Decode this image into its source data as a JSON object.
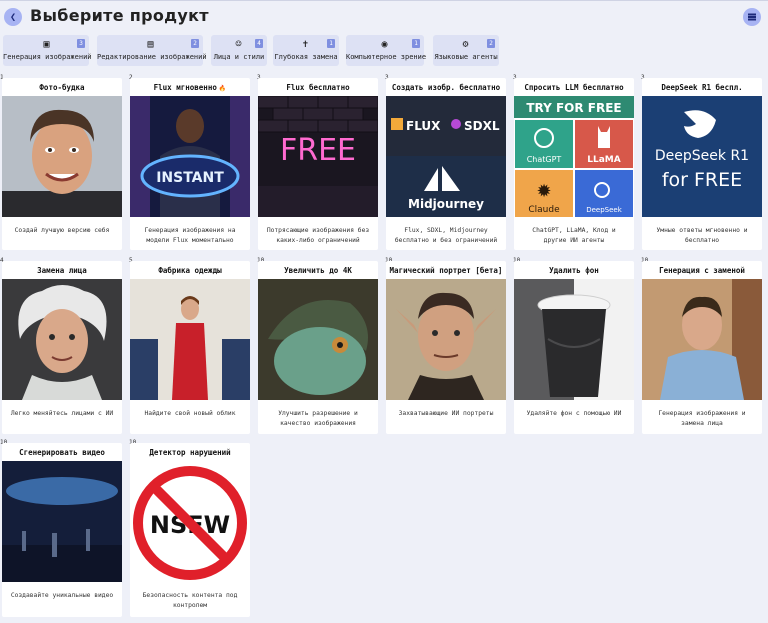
{
  "header": {
    "title": "Выберите продукт"
  },
  "categories": [
    {
      "label": "Генерация изображений",
      "count": "3",
      "icon": "image-edit-icon"
    },
    {
      "label": "Редактирование изображений",
      "count": "2",
      "icon": "image-pencil-icon"
    },
    {
      "label": "Лица и стили",
      "count": "4",
      "icon": "face-frame-icon"
    },
    {
      "label": "Глубокая замена",
      "count": "1",
      "icon": "person-swap-icon"
    },
    {
      "label": "Компьютерное зрение",
      "count": "1",
      "icon": "scan-icon"
    },
    {
      "label": "Языковые агенты",
      "count": "2",
      "icon": "agent-icon"
    }
  ],
  "cards": [
    {
      "num": "1",
      "title": "Фото-будка",
      "desc": "Создай лучшую версию себя",
      "img": "portrait-photo"
    },
    {
      "num": "2",
      "title": "Flux мгновенно",
      "hot": "🔥",
      "desc": "Генерация изображения на модели Flux моментально",
      "img": "instant-neon",
      "img_text": "INSTANT"
    },
    {
      "num": "3",
      "title": "Flux бесплатно",
      "desc": "Потрясающие изображения без каких-либо ограничений",
      "img": "free-neon",
      "img_text": "FREE"
    },
    {
      "num": "3",
      "title": "Создать изобр. бесплатно",
      "desc": "Flux, SDXL, Midjourney бесплатно и без ограничений",
      "img": "flux-sdxl-mj",
      "logos": [
        "FLUX",
        "SDXL",
        "Midjourney"
      ]
    },
    {
      "num": "3",
      "title": "Спросить LLM бесплатно",
      "desc": "ChatGPT, LLaMA, Клод и другие ИИ агенты",
      "img": "llm-grid",
      "banner": "TRY FOR FREE",
      "logos": [
        "ChatGPT",
        "LLaMA",
        "Claude",
        "DeepSeek"
      ]
    },
    {
      "num": "3",
      "title": "DeepSeek R1 беспл.",
      "desc": "Умные ответы мгновенно и бесплатно",
      "img": "deepseek",
      "img_text": [
        "DeepSeek R1",
        "for FREE"
      ]
    },
    {
      "num": "4",
      "title": "Замена лица",
      "desc": "Легко меняйтесь лицами с ИИ",
      "img": "old-man-portrait"
    },
    {
      "num": "5",
      "title": "Фабрика одежды",
      "desc": "Найдите свой новый облик",
      "img": "flight-attendant"
    },
    {
      "num": "10",
      "title": "Увеличить до 4K",
      "desc": "Улучшить разрешение и качество изображения",
      "img": "lizard"
    },
    {
      "num": "10",
      "title": "Магический портрет [бета]",
      "desc": "Захватывающие ИИ портреты",
      "img": "elf-portrait"
    },
    {
      "num": "10",
      "title": "Удалить фон",
      "desc": "Удаляйте фон с помощью ИИ",
      "img": "coffee-cup"
    },
    {
      "num": "10",
      "title": "Генерация с заменой",
      "desc": "Генерация изображения и замена лица",
      "img": "man-cafe"
    },
    {
      "num": "10",
      "title": "Сгенерировать видео",
      "desc": "Создавайте уникальные видео",
      "img": "video-scene"
    },
    {
      "num": "10",
      "title": "Детектор нарушений",
      "desc": "Безопасность контента под контролем",
      "img": "nsfw-sign",
      "img_text": "NSFW"
    }
  ],
  "colors": {
    "accent": "#a7b3f3",
    "badge": "#7f8fe0",
    "background": "#eef0f8",
    "chip": "#dde1f4"
  }
}
